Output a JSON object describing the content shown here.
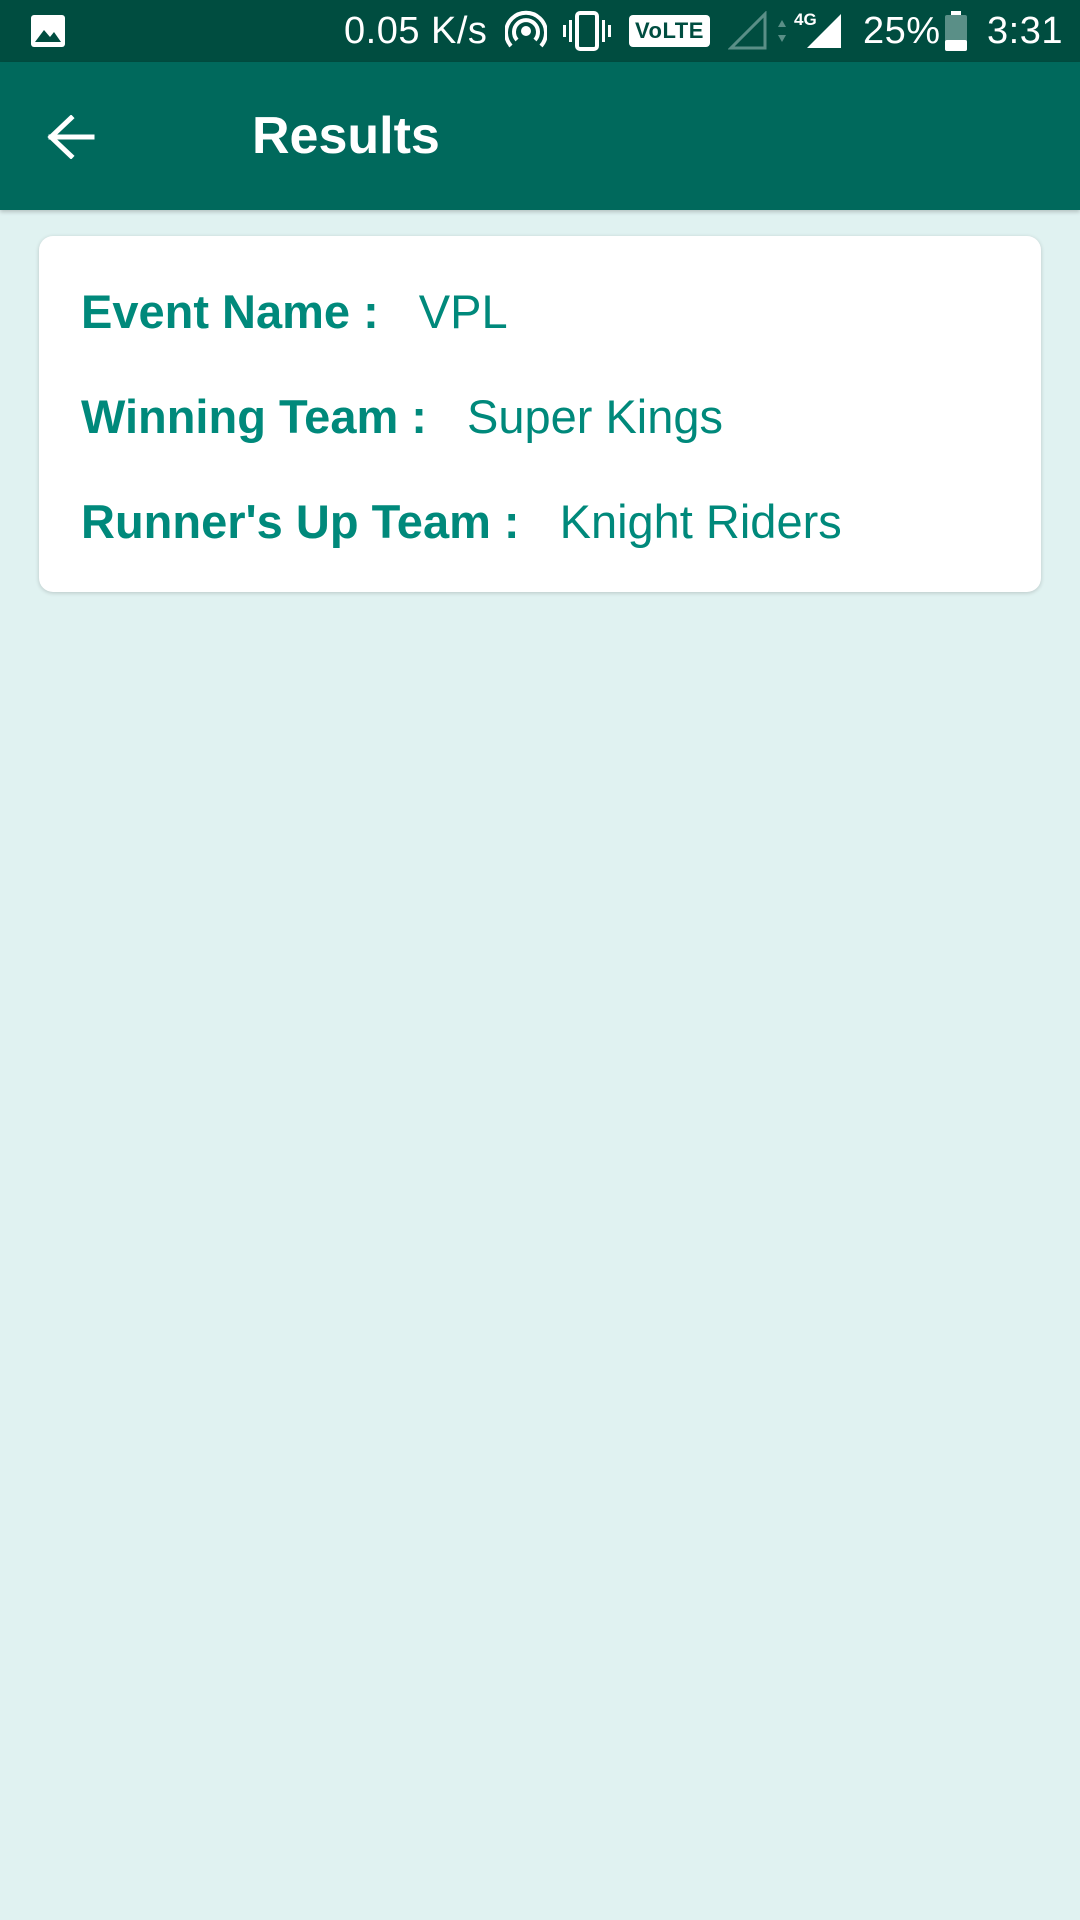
{
  "status_bar": {
    "net_speed": "0.05 K/s",
    "volte": "VoLTE",
    "network_type": "4G",
    "battery": "25%",
    "time": "3:31",
    "background_color": "#004d40",
    "icons": [
      "image-icon",
      "hotspot-icon",
      "vibrate-icon",
      "volte-icon",
      "signal-empty-icon",
      "data-arrows-icon",
      "signal-full-icon",
      "battery-icon"
    ]
  },
  "app_bar": {
    "title": "Results",
    "back_icon": "arrow-back-icon",
    "background_color": "#00695c"
  },
  "result": {
    "event_label": "Event Name :",
    "event_value": "VPL",
    "winning_label": "Winning Team :",
    "winning_value": "Super Kings",
    "runner_label": "Runner's Up Team :",
    "runner_value": "Knight Riders",
    "text_color": "#00897b"
  },
  "page": {
    "background_color": "#e0f2f1"
  }
}
